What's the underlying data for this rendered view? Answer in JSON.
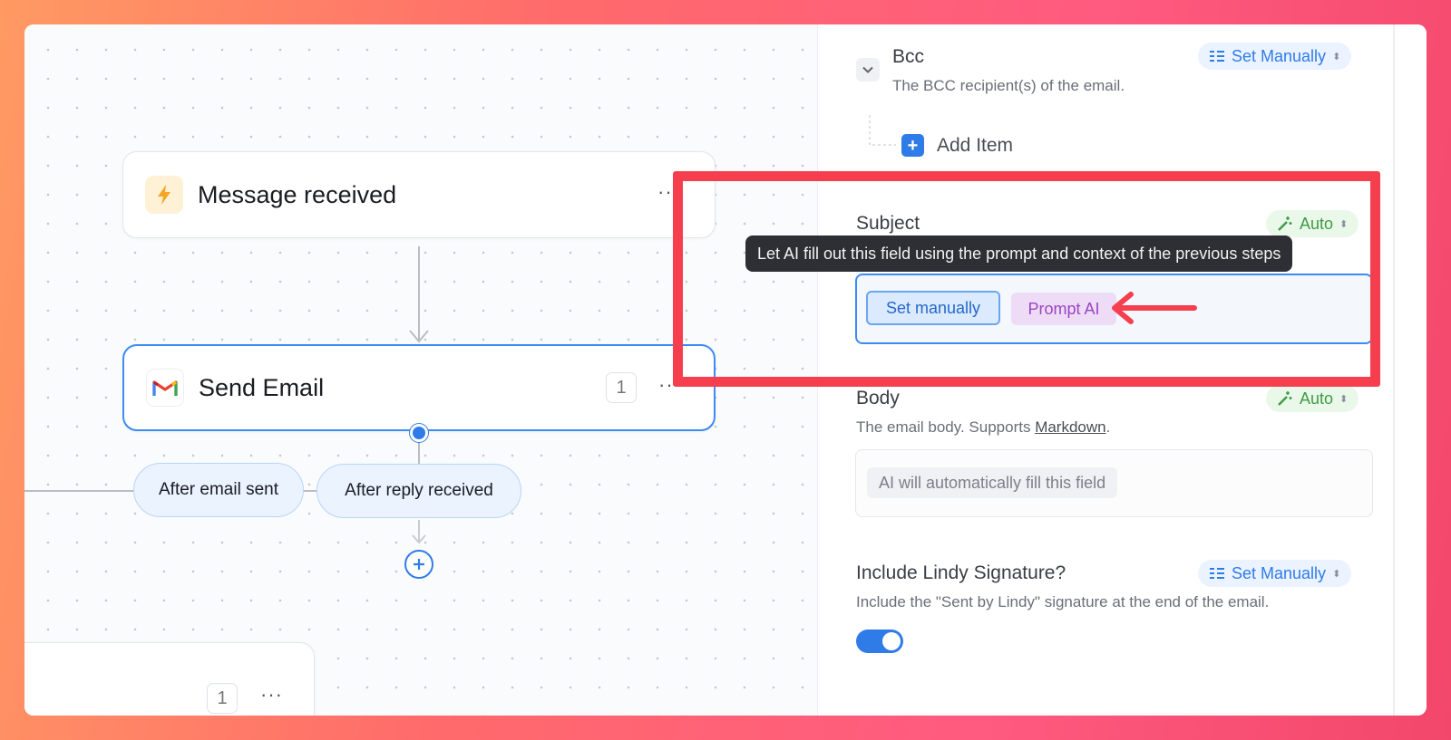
{
  "canvas": {
    "trigger_node": {
      "title": "Message received",
      "icon": "bolt-icon",
      "more": "···"
    },
    "action_node": {
      "title": "Send Email",
      "icon": "gmail-icon",
      "count": "1",
      "more": "···"
    },
    "branches": [
      {
        "label": "After email sent"
      },
      {
        "label": "After reply received"
      }
    ],
    "bottom_node": {
      "count": "1",
      "more": "···"
    }
  },
  "panel": {
    "bcc": {
      "label": "Bcc",
      "description": "The BCC recipient(s) of the email.",
      "mode": "Set Manually",
      "add_item": "Add Item"
    },
    "subject": {
      "label": "Subject",
      "mode": "Auto",
      "tooltip": "Let AI fill out this field using the prompt and context of the previous steps",
      "options": [
        "Set manually",
        "Prompt AI"
      ]
    },
    "body": {
      "label": "Body",
      "mode": "Auto",
      "description_prefix": "The email body. Supports ",
      "description_link": "Markdown",
      "description_suffix": ".",
      "placeholder": "AI will automatically fill this field"
    },
    "signature": {
      "label": "Include Lindy Signature?",
      "mode": "Set Manually",
      "description": "Include the \"Sent by Lindy\" signature at the end of the email.",
      "enabled": true
    }
  },
  "colors": {
    "accent": "#2f7ce8",
    "auto": "#3f9a45",
    "highlight": "#f53f4f",
    "arrow": "#f53f4f"
  }
}
